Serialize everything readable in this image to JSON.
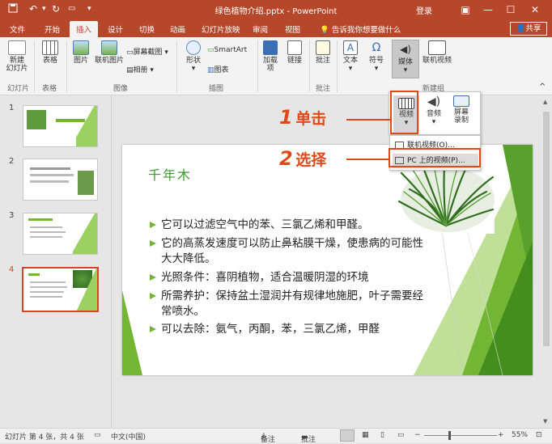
{
  "title_bar": {
    "file_name": "绿色植物介绍.pptx",
    "app_name": "PowerPoint",
    "login": "登录"
  },
  "tabs": [
    "文件",
    "开始",
    "插入",
    "设计",
    "切换",
    "动画",
    "幻灯片放映",
    "审阅",
    "视图"
  ],
  "tell_me": "告诉我你想要做什么",
  "share": "共享",
  "ribbon": {
    "new_slide": "新建\n幻灯片",
    "table": "表格",
    "pictures": "图片",
    "online_pictures": "联机图片",
    "screenshot": "屏幕截图",
    "album": "相册",
    "shapes": "形状",
    "smartart": "SmartArt",
    "chart": "图表",
    "addins": "加载\n项",
    "links": "链接",
    "comment": "批注",
    "text": "文本",
    "symbols": "符号",
    "media": "媒体",
    "online_video": "联机视频",
    "groups": {
      "slides": "幻灯片",
      "tables": "表格",
      "images": "图像",
      "illustrations": "插图",
      "comments": "批注",
      "new_group": "新建组"
    }
  },
  "media_sub": {
    "video": "视频",
    "audio": "音频",
    "screen_recording": "屏幕\n录制"
  },
  "dropdown": {
    "online_video": "联机视频(O)...",
    "pc_video": "PC 上的视频(P)..."
  },
  "thumbnails": [
    {
      "num": "1"
    },
    {
      "num": "2"
    },
    {
      "num": "3"
    },
    {
      "num": "4"
    }
  ],
  "slide": {
    "title": "千年木",
    "bullets": [
      "它可以过滤空气中的苯、三氯乙烯和甲醛。",
      "它的高蒸发速度可以防止鼻粘膜干燥，使患病的可能性大大降低。",
      "光照条件：喜阴植物，适合温暖阴湿的环境",
      "所需养护：保持盆土湿润并有规律地施肥，叶子需要经常喷水。",
      "可以去除：氨气，丙酮，苯，三氯乙烯，甲醛"
    ]
  },
  "annotations": [
    {
      "num": "1",
      "text": "单击"
    },
    {
      "num": "2",
      "text": "选择"
    }
  ],
  "status": {
    "slide_info": "幻灯片 第 4 张，共 4 张",
    "language": "中文(中国)",
    "notes": "备注",
    "comments": "批注",
    "zoom": "55%"
  },
  "colors": {
    "accent": "#b7472a",
    "annotation": "#e04a1a",
    "green": "#74b634"
  }
}
